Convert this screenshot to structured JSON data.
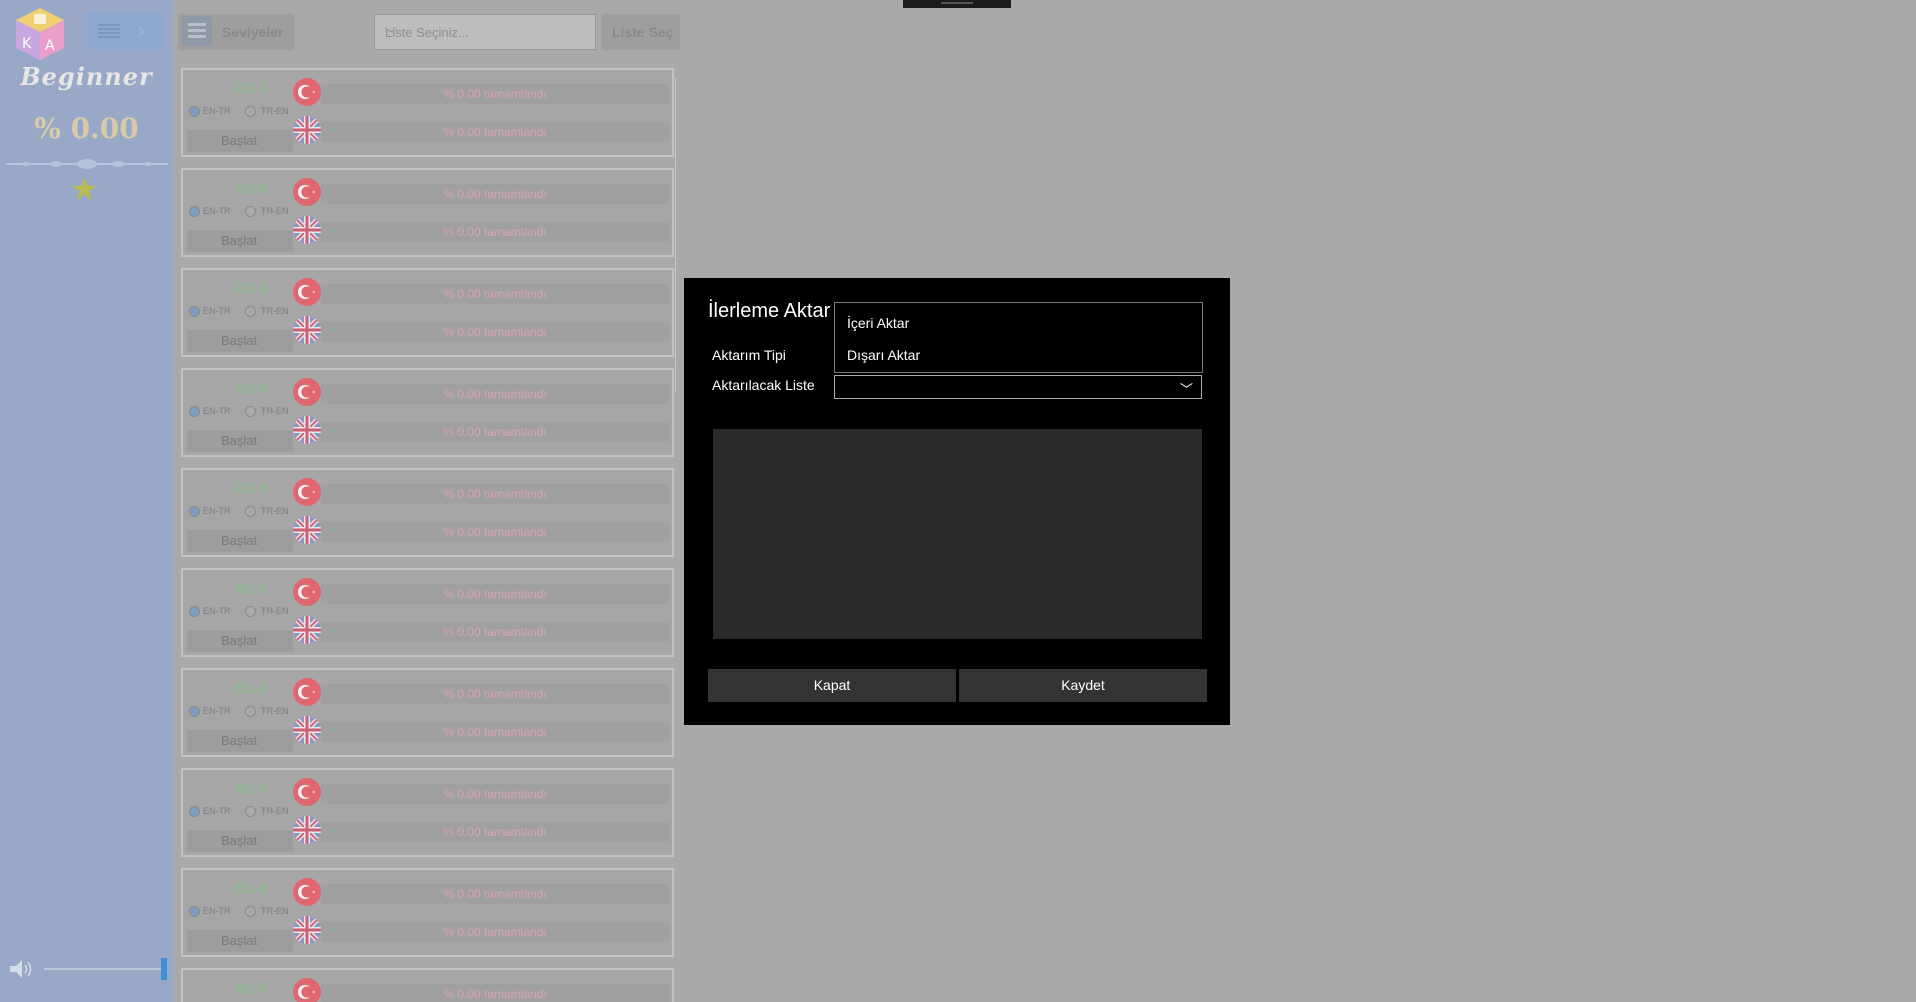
{
  "sidebar": {
    "level_title": "Beginner",
    "progress_percent": "% 0.00",
    "volume_level": 1.0
  },
  "topbar": {
    "levels_label": "Seviyeler",
    "list_placeholder": "Liste Seçiniz...",
    "list_button": "Liste Seç"
  },
  "cards": [
    {
      "code": "A2-1",
      "radio1": "EN-TR",
      "radio2": "TR-EN",
      "start": "Başlat",
      "tr_progress": "% 0.00 tamamlandı",
      "en_progress": "% 0.00 tamamlandı"
    },
    {
      "code": "A2-2",
      "radio1": "EN-TR",
      "radio2": "TR-EN",
      "start": "Başlat",
      "tr_progress": "% 0.00 tamamlandı",
      "en_progress": "% 0.00 tamamlandı"
    },
    {
      "code": "A2-3",
      "radio1": "EN-TR",
      "radio2": "TR-EN",
      "start": "Başlat",
      "tr_progress": "% 0.00 tamamlandı",
      "en_progress": "% 0.00 tamamlandı"
    },
    {
      "code": "A2-4",
      "radio1": "EN-TR",
      "radio2": "TR-EN",
      "start": "Başlat",
      "tr_progress": "% 0.00 tamamlandı",
      "en_progress": "% 0.00 tamamlandı"
    },
    {
      "code": "A2-5",
      "radio1": "EN-TR",
      "radio2": "TR-EN",
      "start": "Başlat",
      "tr_progress": "% 0.00 tamamlandı",
      "en_progress": "% 0.00 tamamlandı"
    },
    {
      "code": "B1-1",
      "radio1": "EN-TR",
      "radio2": "TR-EN",
      "start": "Başlat",
      "tr_progress": "% 0.00 tamamlandı",
      "en_progress": "% 0.00 tamamlandı"
    },
    {
      "code": "B1-2",
      "radio1": "EN-TR",
      "radio2": "TR-EN",
      "start": "Başlat",
      "tr_progress": "% 0.00 tamamlandı",
      "en_progress": "% 0.00 tamamlandı"
    },
    {
      "code": "B1-3",
      "radio1": "EN-TR",
      "radio2": "TR-EN",
      "start": "Başlat",
      "tr_progress": "% 0.00 tamamlandı",
      "en_progress": "% 0.00 tamamlandı"
    },
    {
      "code": "B1-4",
      "radio1": "EN-TR",
      "radio2": "TR-EN",
      "start": "Başlat",
      "tr_progress": "% 0.00 tamamlandı",
      "en_progress": "% 0.00 tamamlandı"
    },
    {
      "code": "B1-5",
      "radio1": "",
      "radio2": "",
      "start": "",
      "tr_progress": "% 0.00 tamamlandı",
      "en_progress": ""
    }
  ],
  "dialog": {
    "title": "İlerleme Aktar",
    "transfer_type_label": "Aktarım Tipi",
    "target_list_label": "Aktarılacak Liste",
    "transfer_options": [
      "İçeri Aktar",
      "Dışarı Aktar"
    ],
    "close_button": "Kapat",
    "save_button": "Kaydet"
  },
  "colors": {
    "sidebar_bg": "#98a8c6",
    "overlay_bg": "#a9a9a9",
    "dialog_bg": "#000000",
    "accent_blue": "#3f8fd6",
    "tr_flag": "#e06670",
    "level_code": "#8fba8f",
    "progress_text": "#d9a3b3"
  }
}
